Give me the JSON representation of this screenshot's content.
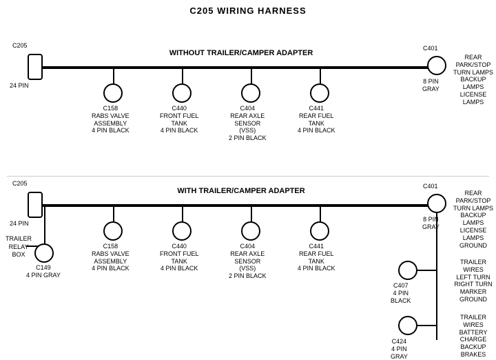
{
  "title": "C205 WIRING HARNESS",
  "section1": {
    "label": "WITHOUT TRAILER/CAMPER ADAPTER",
    "connectors": [
      {
        "id": "C205_top",
        "label": "C205",
        "sublabel": "24 PIN",
        "type": "rect"
      },
      {
        "id": "C401_top",
        "label": "C401",
        "sublabel": "8 PIN\nGRAY",
        "type": "circle"
      },
      {
        "id": "C158_top",
        "label": "C158",
        "sublabel": "RABS VALVE\nASSEMBLY\n4 PIN BLACK",
        "type": "circle"
      },
      {
        "id": "C440_top",
        "label": "C440",
        "sublabel": "FRONT FUEL\nTANK\n4 PIN BLACK",
        "type": "circle"
      },
      {
        "id": "C404_top",
        "label": "C404",
        "sublabel": "REAR AXLE\nSENSOR\n(VSS)\n2 PIN BLACK",
        "type": "circle"
      },
      {
        "id": "C441_top",
        "label": "C441",
        "sublabel": "REAR FUEL\nTANK\n4 PIN BLACK",
        "type": "circle"
      }
    ],
    "right_label": "REAR PARK/STOP\nTURN LAMPS\nBACKUP LAMPS\nLICENSE LAMPS"
  },
  "section2": {
    "label": "WITH TRAILER/CAMPER ADAPTER",
    "connectors": [
      {
        "id": "C205_bot",
        "label": "C205",
        "sublabel": "24 PIN",
        "type": "rect"
      },
      {
        "id": "C401_bot",
        "label": "C401",
        "sublabel": "8 PIN\nGRAY",
        "type": "circle"
      },
      {
        "id": "C158_bot",
        "label": "C158",
        "sublabel": "RABS VALVE\nASSEMBLY\n4 PIN BLACK",
        "type": "circle"
      },
      {
        "id": "C440_bot",
        "label": "C440",
        "sublabel": "FRONT FUEL\nTANK\n4 PIN BLACK",
        "type": "circle"
      },
      {
        "id": "C404_bot",
        "label": "C404",
        "sublabel": "REAR AXLE\nSENSOR\n(VSS)\n2 PIN BLACK",
        "type": "circle"
      },
      {
        "id": "C441_bot",
        "label": "C441",
        "sublabel": "REAR FUEL\nTANK\n4 PIN BLACK",
        "type": "circle"
      },
      {
        "id": "C149",
        "label": "C149",
        "sublabel": "4 PIN GRAY",
        "type": "circle"
      },
      {
        "id": "C407",
        "label": "C407",
        "sublabel": "4 PIN\nBLACK",
        "type": "circle"
      },
      {
        "id": "C424",
        "label": "C424",
        "sublabel": "4 PIN\nGRAY",
        "type": "circle"
      }
    ],
    "right_label1": "REAR PARK/STOP\nTURN LAMPS\nBACKUP LAMPS\nLICENSE LAMPS\nGROUND",
    "right_label2": "TRAILER WIRES\nLEFT TURN\nRIGHT TURN\nMARKER\nGROUND",
    "right_label3": "TRAILER WIRES\nBATTERY CHARGE\nBACKUP\nBRAKES",
    "left_label": "TRAILER\nRELAY\nBOX"
  }
}
